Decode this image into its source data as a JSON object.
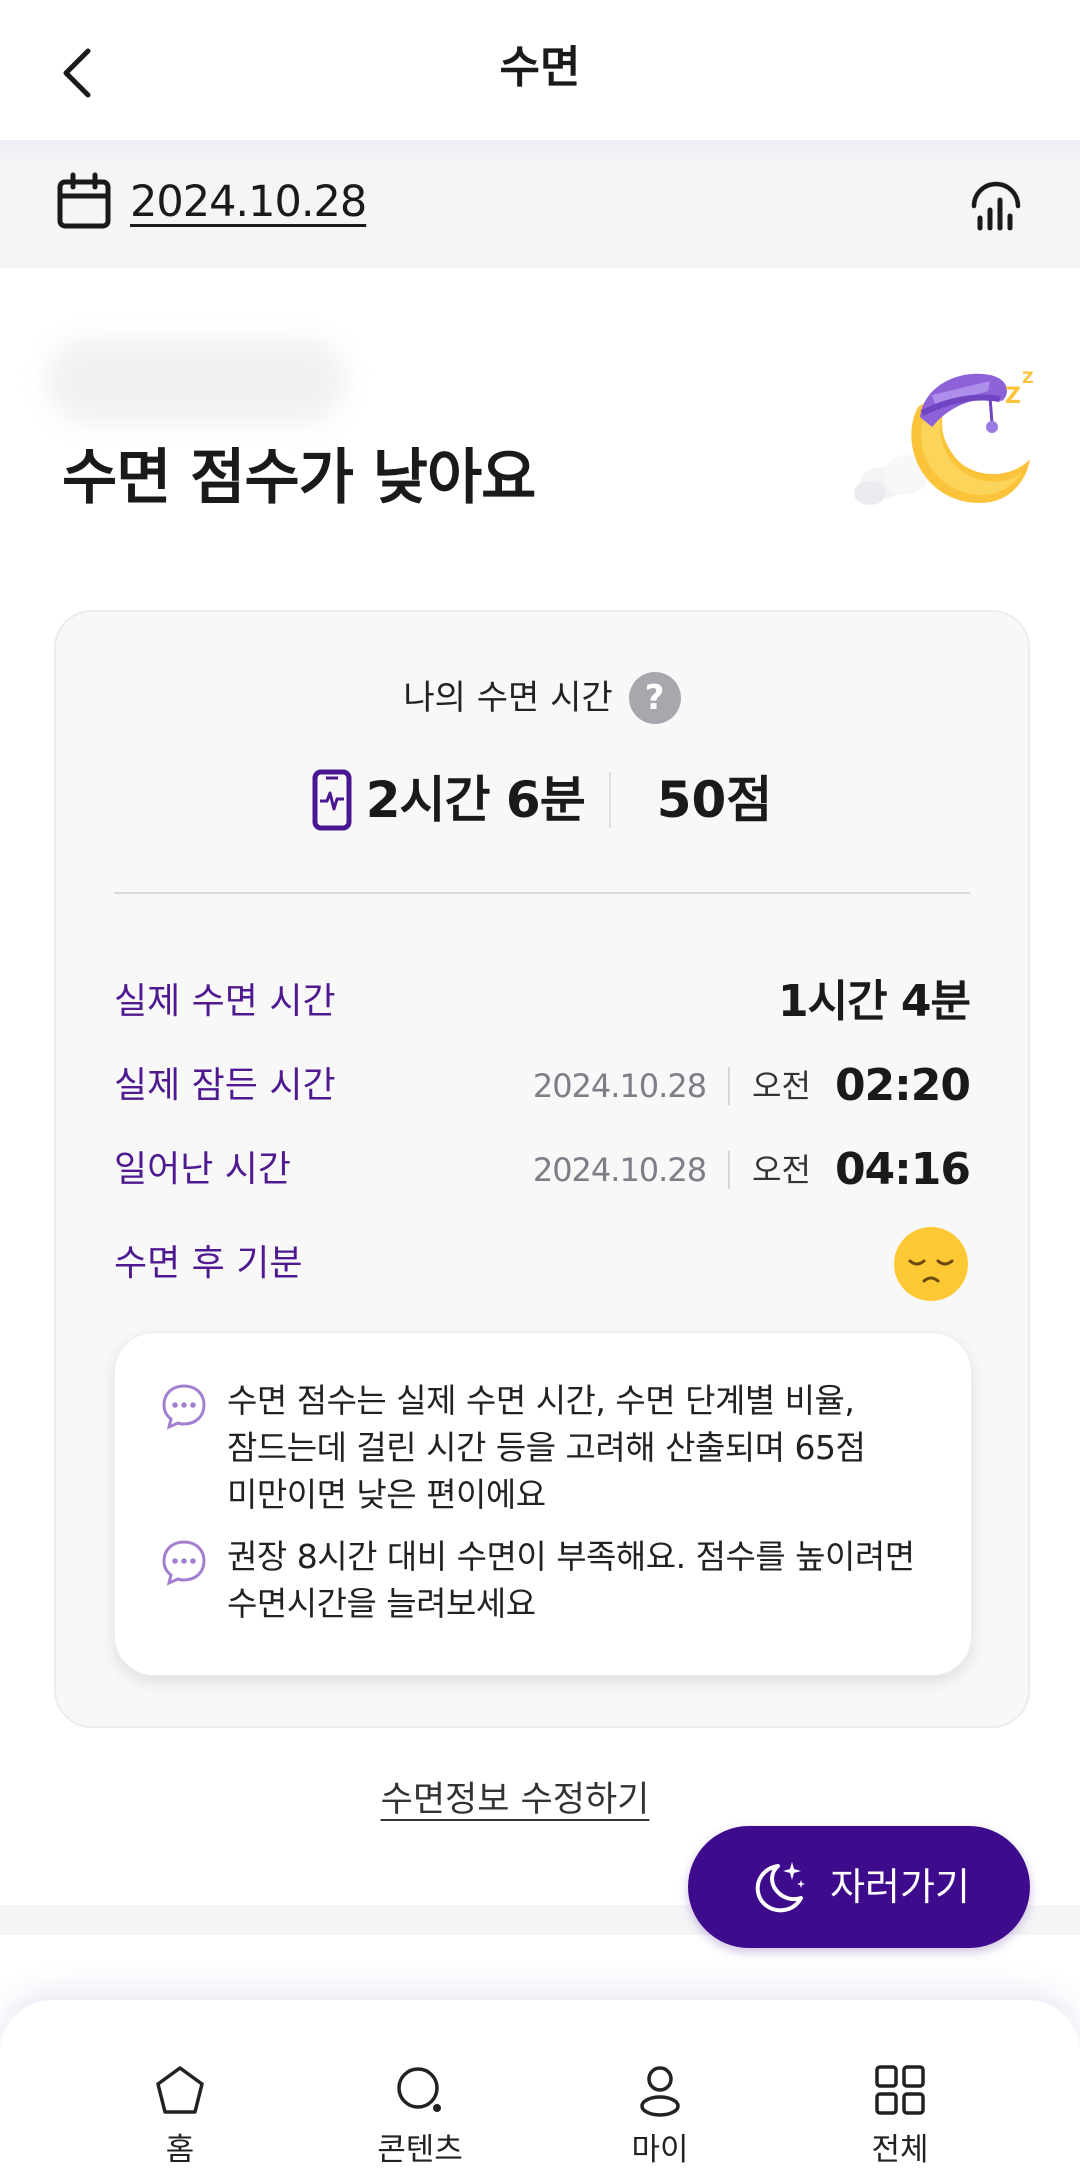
{
  "header": {
    "title": "수면",
    "back_icon": "chevron-left-icon"
  },
  "date_bar": {
    "date": "2024.10.28",
    "calendar_icon": "calendar-icon",
    "chart_icon": "bar-chart-icon"
  },
  "hero": {
    "headline": "수면 점수가 낮아요",
    "illustration": "sleeping-moon-icon"
  },
  "card": {
    "title": "나의 수면 시간",
    "help_icon_text": "?",
    "summary": {
      "device_icon": "phone-heartbeat-icon",
      "total_time": "2시간 6분",
      "score": "50점"
    },
    "rows": [
      {
        "label": "실제 수면 시간",
        "value": "1시간 4분"
      },
      {
        "label": "실제 잠든 시간",
        "date": "2024.10.28",
        "ampm": "오전",
        "time": "02:20"
      },
      {
        "label": "일어난 시간",
        "date": "2024.10.28",
        "ampm": "오전",
        "time": "04:16"
      },
      {
        "label": "수면 후 기분",
        "mood_icon": "sleepy-face-icon"
      }
    ],
    "notices": [
      {
        "line1": "수면 점수는 실제 수면 시간, 수면 단계별 비율,",
        "line2": "잠드는데 걸린 시간 등을 고려해 산출되며 65점",
        "line3": "미만이면 낮은 편이에요"
      },
      {
        "line1": "권장 8시간 대비 수면이 부족해요. 점수를 높이려면",
        "line2": "수면시간을 늘려보세요"
      }
    ]
  },
  "edit_link": "수면정보 수정하기",
  "sleep_button": {
    "label": "자러가기",
    "icon": "moon-stars-icon"
  },
  "bottom_nav": [
    {
      "label": "홈",
      "icon": "home-icon"
    },
    {
      "label": "콘텐츠",
      "icon": "search-content-icon"
    },
    {
      "label": "마이",
      "icon": "person-icon"
    },
    {
      "label": "전체",
      "icon": "grid-icon"
    }
  ],
  "colors": {
    "accent": "#3d0b8c",
    "label_purple": "#4f1a8f",
    "date_gray": "#7d7f86"
  }
}
